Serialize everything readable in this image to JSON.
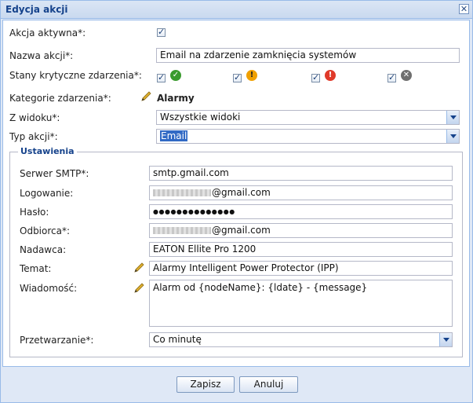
{
  "window": {
    "title": "Edycja akcji",
    "close_icon": "close-icon"
  },
  "form": {
    "active_label": "Akcja aktywna*:",
    "active_checked": true,
    "name_label": "Nazwa akcji*:",
    "name_value": "Email na zdarzenie zamknięcia systemów",
    "states_label": "Stany krytyczne zdarzenia*:",
    "states": [
      {
        "icon": "ok-icon",
        "checked": true,
        "color": "#3a9b2e",
        "glyph": "✓"
      },
      {
        "icon": "warning-icon",
        "checked": true,
        "color": "#f0a000",
        "glyph": "!"
      },
      {
        "icon": "critical-icon",
        "checked": true,
        "color": "#e03a2a",
        "glyph": "!"
      },
      {
        "icon": "unknown-icon",
        "checked": true,
        "color": "#6f6f6f",
        "glyph": "✕"
      }
    ],
    "category_label": "Kategorie zdarzenia*:",
    "category_value": "Alarmy",
    "view_label": "Z widoku*:",
    "view_value": "Wszystkie widoki",
    "type_label": "Typ akcji*:",
    "type_value": "Email"
  },
  "settings": {
    "legend": "Ustawienia",
    "smtp_label": "Serwer SMTP*:",
    "smtp_value": "smtp.gmail.com",
    "login_label": "Logowanie:",
    "login_suffix": "@gmail.com",
    "password_label": "Hasło:",
    "password_mask": "●●●●●●●●●●●●●●",
    "recipient_label": "Odbiorca*:",
    "recipient_suffix": "@gmail.com",
    "sender_label": "Nadawca:",
    "sender_value": "EATON Ellite Pro 1200",
    "subject_label": "Temat:",
    "subject_value": "Alarmy Intelligent Power Protector (IPP)",
    "message_label": "Wiadomość:",
    "message_value": "Alarm od {nodeName}: {ldate} - {message}",
    "processing_label": "Przetwarzanie*:",
    "processing_value": "Co minutę"
  },
  "buttons": {
    "save": "Zapisz",
    "cancel": "Anuluj"
  }
}
